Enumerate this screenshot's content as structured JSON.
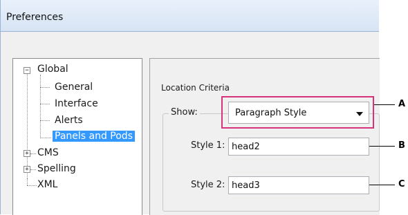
{
  "window": {
    "title": "Preferences"
  },
  "tree": {
    "root_global": "Global",
    "global_children": [
      "General",
      "Interface",
      "Alerts",
      "Panels and Pods"
    ],
    "root_cms": "CMS",
    "root_spelling": "Spelling",
    "root_xml": "XML",
    "expanded_symbol": "−",
    "collapsed_symbol": "+"
  },
  "settings": {
    "section_title": "Location Criteria",
    "show_label": "Show:",
    "show_value": "Paragraph Style",
    "style1_label": "Style 1:",
    "style1_value": "head2",
    "style2_label": "Style 2:",
    "style2_value": "head3"
  },
  "callouts": [
    "A",
    "B",
    "C"
  ],
  "colors": {
    "selection": "#3399ff",
    "highlight": "#d6337a"
  }
}
